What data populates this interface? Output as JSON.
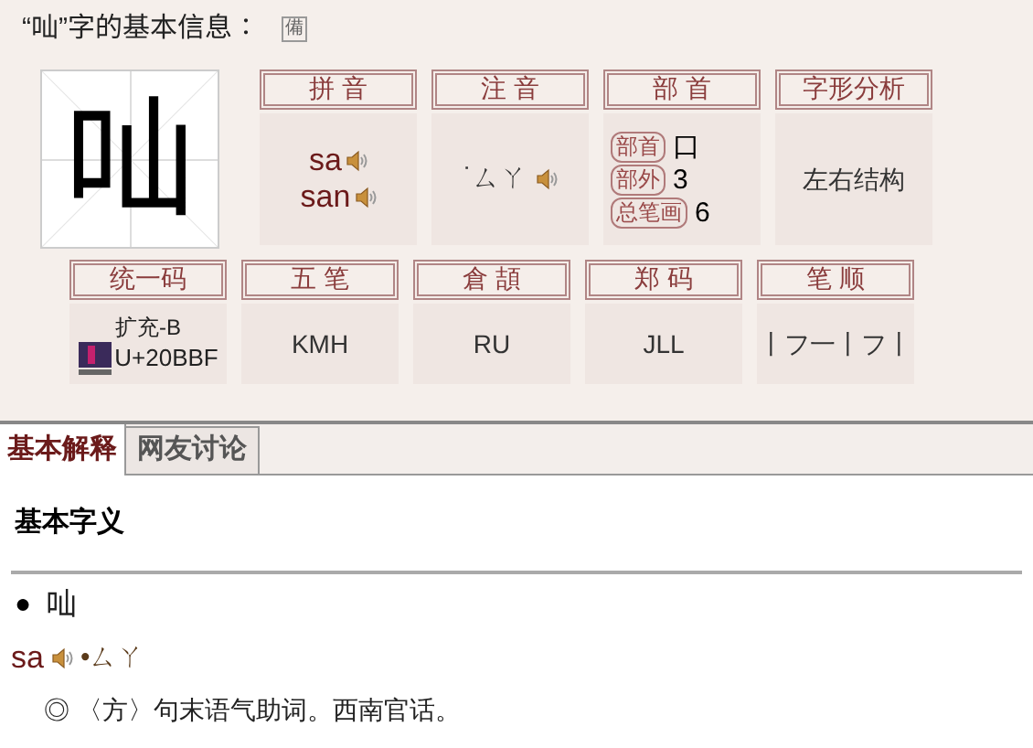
{
  "title": "“𠮿”字的基本信息：",
  "title_badge": "備",
  "character": "𠮿",
  "row_1": [
    {
      "header": "拼 音",
      "kind": "pinyin",
      "readings": [
        "sa",
        "san"
      ]
    },
    {
      "header": "注 音",
      "kind": "zhuyin",
      "value": "˙ㄙㄚ"
    },
    {
      "header": "部 首",
      "kind": "radical",
      "items": [
        {
          "label": "部首",
          "value": "口"
        },
        {
          "label": "部外",
          "value": "3"
        },
        {
          "label": "总笔画",
          "value": "6"
        }
      ]
    },
    {
      "header": "字形分析",
      "kind": "text",
      "value": "左右结构"
    }
  ],
  "row_2": [
    {
      "header": "统一码",
      "kind": "unicode",
      "block": "扩充-B",
      "value": "U+20BBF"
    },
    {
      "header": "五 笔",
      "kind": "text",
      "value": "KMH"
    },
    {
      "header": "倉 頡",
      "kind": "text",
      "value": "RU"
    },
    {
      "header": "郑 码",
      "kind": "text",
      "value": "JLL"
    },
    {
      "header": "笔 顺",
      "kind": "text",
      "value": "丨フ一丨フ丨"
    }
  ],
  "tabs": [
    {
      "label": "基本解释",
      "selected": true
    },
    {
      "label": "网友讨论",
      "selected": false
    }
  ],
  "section_heading": "基本字义",
  "entry": {
    "bullet": "●",
    "character": "𠮿",
    "pinyin": "sa",
    "zhuyin": "•ㄙㄚ",
    "definitions": [
      "◎ 〈方〉句末语气助词。西南官话。"
    ]
  }
}
